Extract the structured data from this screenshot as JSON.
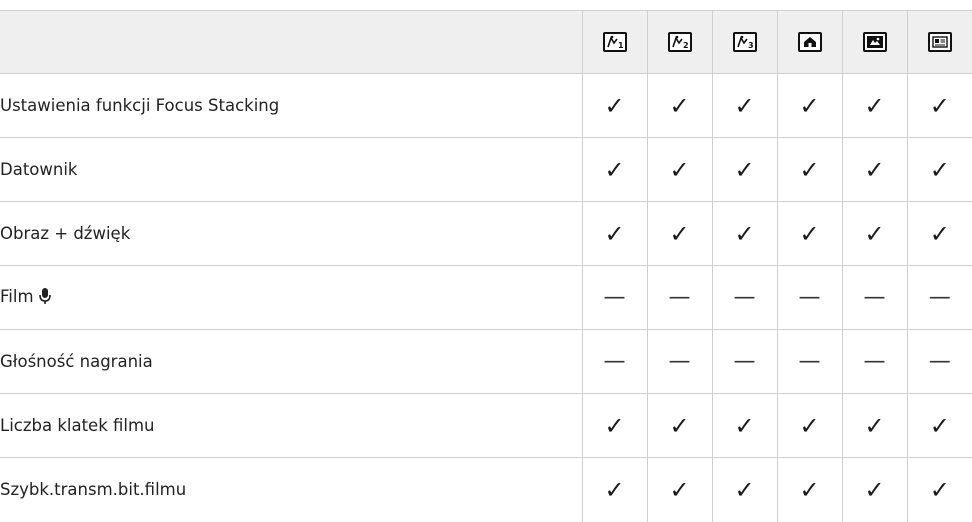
{
  "header": {
    "modes": [
      {
        "icon": "art-filter-1-icon"
      },
      {
        "icon": "art-filter-2-icon"
      },
      {
        "icon": "art-filter-3-icon"
      },
      {
        "icon": "home-mode-icon"
      },
      {
        "icon": "scene-mode-icon"
      },
      {
        "icon": "custom-mode-icon"
      }
    ]
  },
  "rows": [
    {
      "label": "Ustawienia funkcji Focus Stacking",
      "marks": [
        "✓",
        "✓",
        "✓",
        "✓",
        "✓",
        "✓"
      ]
    },
    {
      "label": "Datownik",
      "marks": [
        "✓",
        "✓",
        "✓",
        "✓",
        "✓",
        "✓"
      ]
    },
    {
      "label": "Obraz + dźwięk",
      "marks": [
        "✓",
        "✓",
        "✓",
        "✓",
        "✓",
        "✓"
      ]
    },
    {
      "label": "Film",
      "icon": "microphone-icon",
      "marks": [
        "—",
        "—",
        "—",
        "—",
        "—",
        "—"
      ]
    },
    {
      "label": "Głośność nagrania",
      "marks": [
        "—",
        "—",
        "—",
        "—",
        "—",
        "—"
      ]
    },
    {
      "label": "Liczba klatek filmu",
      "marks": [
        "✓",
        "✓",
        "✓",
        "✓",
        "✓",
        "✓"
      ]
    },
    {
      "label": "Szybk.transm.bit.filmu",
      "marks": [
        "✓",
        "✓",
        "✓",
        "✓",
        "✓",
        "✓"
      ]
    }
  ]
}
